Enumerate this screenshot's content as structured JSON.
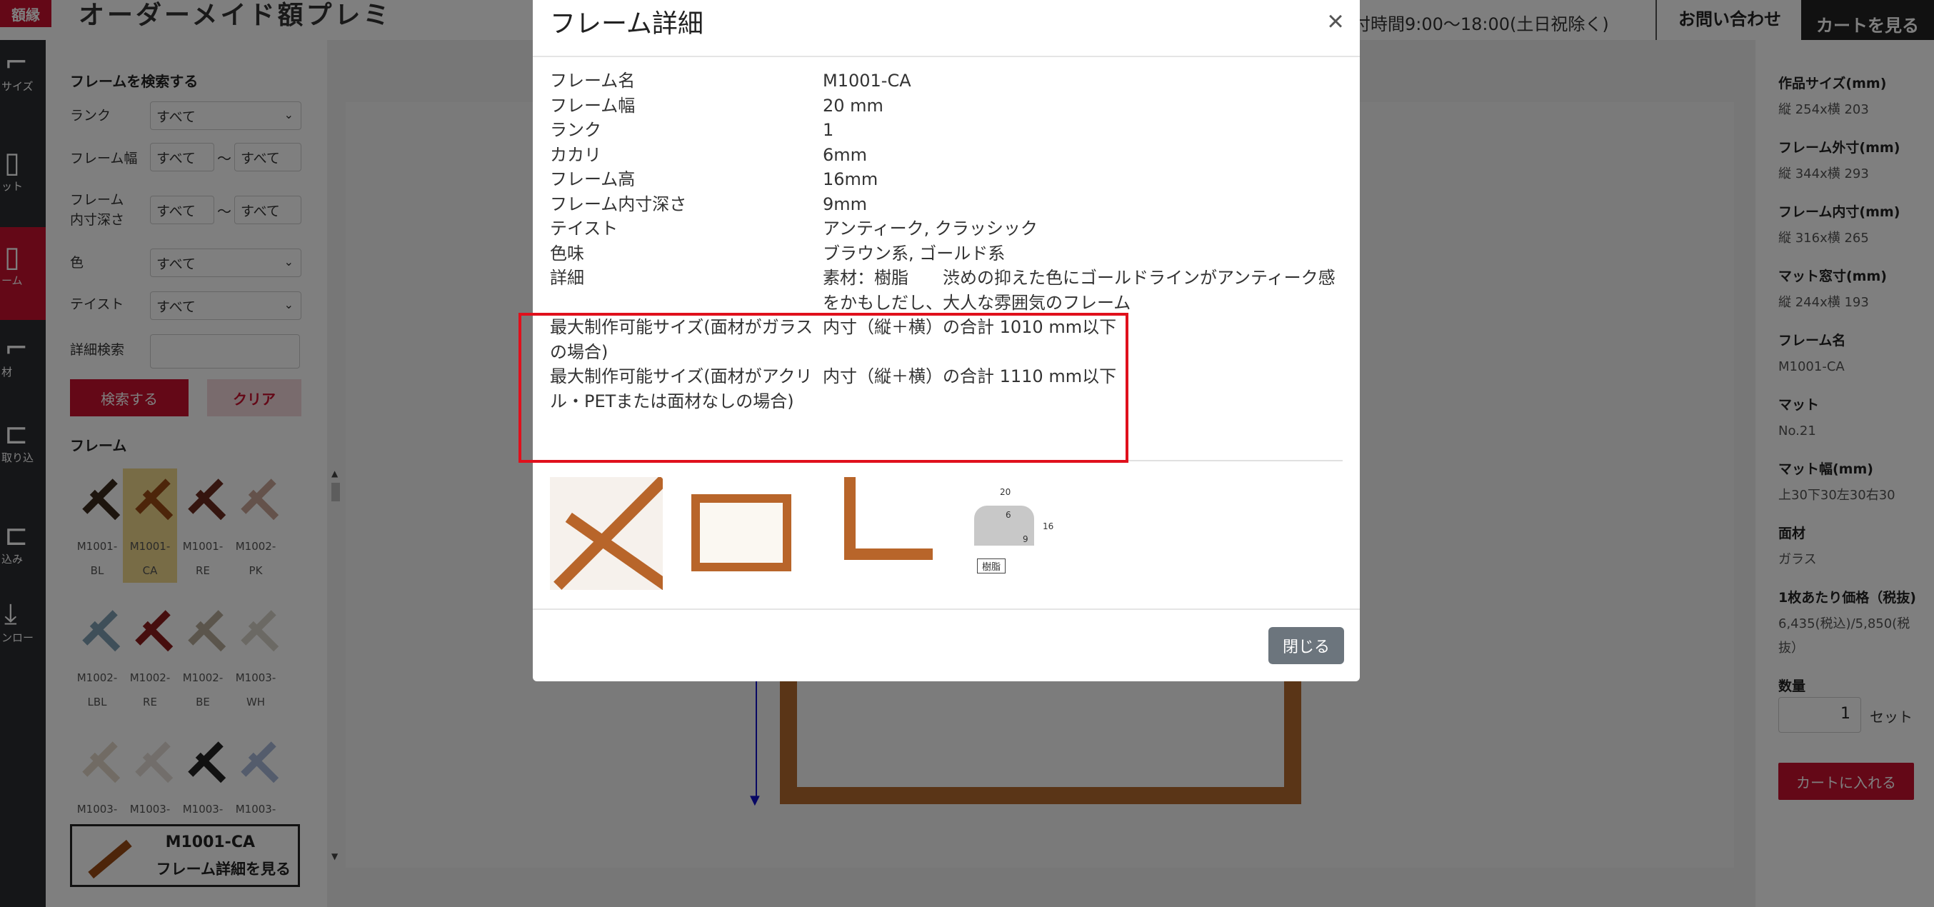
{
  "header": {
    "logo_text": "額縁",
    "site_title": "オーダーメイド額プレミ",
    "hours": "付時間9:00〜18:00(土日祝除く)",
    "contact_label": "お問い合わせ",
    "cart_label": "カートを見る"
  },
  "iconbar": {
    "items": [
      {
        "label": "サイズ",
        "icon": "size-icon"
      },
      {
        "label": "ット",
        "icon": "mat-icon"
      },
      {
        "label": "ーム",
        "icon": "frame-icon"
      },
      {
        "label": "材",
        "icon": "material-icon"
      },
      {
        "label": "取り込",
        "icon": "import-icon"
      },
      {
        "label": "込み",
        "icon": "insert-icon"
      },
      {
        "label": "ンロー",
        "icon": "download-icon"
      }
    ]
  },
  "search": {
    "heading": "フレームを検索する",
    "rank_label": "ランク",
    "rank_value": "すべて",
    "width_label": "フレーム幅",
    "width_from": "すべて",
    "width_to": "すべて",
    "depth_label": "フレーム内寸深さ",
    "depth_from": "すべて",
    "depth_to": "すべて",
    "color_label": "色",
    "color_value": "すべて",
    "taste_label": "テイスト",
    "taste_value": "すべて",
    "detail_label": "詳細検索",
    "tilde": "〜",
    "search_button": "検索する",
    "clear_button": "クリア"
  },
  "frames": {
    "heading": "フレーム",
    "items": [
      {
        "code": "M1001-",
        "suffix": "BL",
        "color": "#3a2a1c"
      },
      {
        "code": "M1001-",
        "suffix": "CA",
        "color": "#9a4a14"
      },
      {
        "code": "M1001-",
        "suffix": "RE",
        "color": "#6a2a1e"
      },
      {
        "code": "M1002-",
        "suffix": "PK",
        "color": "#c9a597"
      },
      {
        "code": "M1002-",
        "suffix": "LBL",
        "color": "#7e9fb3"
      },
      {
        "code": "M1002-",
        "suffix": "RE",
        "color": "#8c1c1c"
      },
      {
        "code": "M1002-",
        "suffix": "BE",
        "color": "#b6ab98"
      },
      {
        "code": "M1003-",
        "suffix": "WH",
        "color": "#d7d3c8"
      },
      {
        "code": "M1003-",
        "suffix": "",
        "color": "#e2d7c8"
      },
      {
        "code": "M1003-",
        "suffix": "",
        "color": "#e4ddd6"
      },
      {
        "code": "M1003-",
        "suffix": "",
        "color": "#222222"
      },
      {
        "code": "M1003-",
        "suffix": "",
        "color": "#a8b8d8"
      }
    ],
    "selected_code": "M1001-CA",
    "selected_detail": "フレーム詳細を見る"
  },
  "summary": [
    {
      "h": "作品サイズ(mm)",
      "v": "縦 254x横 203"
    },
    {
      "h": "フレーム外寸(mm)",
      "v": "縦 344x横 293"
    },
    {
      "h": "フレーム内寸(mm)",
      "v": "縦 316x横 265"
    },
    {
      "h": "マット窓寸(mm)",
      "v": "縦 244x横 193"
    },
    {
      "h": "フレーム名",
      "v": "M1001-CA"
    },
    {
      "h": "マット",
      "v": "No.21"
    },
    {
      "h": "マット幅(mm)",
      "v": "上30下30左30右30"
    },
    {
      "h": "面材",
      "v": "ガラス"
    },
    {
      "h": "1枚あたり価格（税抜)",
      "v": "6,435(税込)/5,850(税抜）"
    },
    {
      "h": "数量",
      "v": ""
    }
  ],
  "quantity": {
    "value": "1",
    "unit": "セット"
  },
  "add_to_cart": "カートに入れる",
  "modal": {
    "title": "フレーム詳細",
    "rows": [
      {
        "k": "フレーム名",
        "v": "M1001-CA"
      },
      {
        "k": "フレーム幅",
        "v": "20 mm"
      },
      {
        "k": "ランク",
        "v": "1"
      },
      {
        "k": "カカリ",
        "v": "6mm"
      },
      {
        "k": "フレーム高",
        "v": "16mm"
      },
      {
        "k": "フレーム内寸深さ",
        "v": "9mm"
      },
      {
        "k": "テイスト",
        "v": "アンティーク, クラッシック"
      },
      {
        "k": "色味",
        "v": "ブラウン系, ゴールド系"
      },
      {
        "k": "詳細",
        "v": "素材：樹脂　　渋めの抑えた色にゴールドラインがアンティーク感をかもしだし、大人な雰囲気のフレーム"
      },
      {
        "k": "最大制作可能サイズ(面材がガラスの場合)",
        "v": "内寸（縦＋横）の合計 1010 mm以下"
      },
      {
        "k": "最大制作可能サイズ(面材がアクリル・PETまたは面材なしの場合)",
        "v": "内寸（縦＋横）の合計 1110 mm以下"
      }
    ],
    "profile": {
      "w": "20",
      "kakari": "6",
      "h": "16",
      "depth": "9",
      "material_tag": "樹脂"
    },
    "close_button": "閉じる"
  }
}
